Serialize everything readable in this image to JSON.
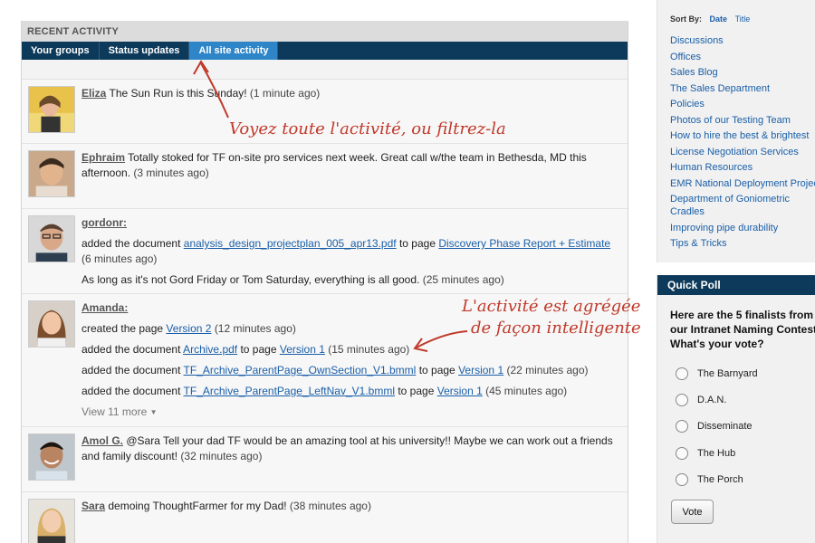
{
  "activity": {
    "header": "RECENT ACTIVITY",
    "tabs": [
      "Your groups",
      "Status updates",
      "All site activity"
    ],
    "items": [
      {
        "user": "Eliza",
        "lines": [
          {
            "text": "The Sun Run is this Sunday!",
            "time": "(1 minute ago)"
          }
        ]
      },
      {
        "user": "Ephraim",
        "lines": [
          {
            "text": "Totally stoked for TF on-site pro services next week. Great call w/the team in Bethesda, MD this afternoon.",
            "time": "(3 minutes ago)"
          }
        ]
      },
      {
        "user": "gordonr:",
        "lines": [
          {
            "pre": "added the document",
            "doc": "analysis_design_projectplan_005_apr13.pdf",
            "mid": "to page",
            "page": "Discovery Phase Report + Estimate",
            "time": "(6 minutes ago)"
          },
          {
            "text": "As long as it's not Gord Friday or Tom Saturday, everything is all good.",
            "time": "(25 minutes ago)"
          }
        ]
      },
      {
        "user": "Amanda:",
        "lines": [
          {
            "pre": "created the page",
            "page": "Version 2",
            "time": "(12 minutes ago)"
          },
          {
            "pre": "added the document",
            "doc": "Archive.pdf",
            "mid": "to page",
            "page": "Version 1",
            "time": "(15 minutes ago)"
          },
          {
            "pre": "added the document",
            "doc": "TF_Archive_ParentPage_OwnSection_V1.bmml",
            "mid": "to page",
            "page": "Version 1",
            "time": "(22 minutes ago)"
          },
          {
            "pre": "added the document",
            "doc": "TF_Archive_ParentPage_LeftNav_V1.bmml",
            "mid": "to page",
            "page": "Version 1",
            "time": "(45 minutes ago)"
          }
        ],
        "view_more": "View 11 more"
      },
      {
        "user": "Amol G.",
        "lines": [
          {
            "text": "@Sara Tell your dad TF would be an amazing tool at his university!! Maybe we can work out a friends and family discount!",
            "time": "(32 minutes ago)"
          }
        ]
      },
      {
        "user": "Sara",
        "lines": [
          {
            "text": "demoing ThoughtFarmer for my Dad!",
            "time": "(38 minutes ago)"
          }
        ]
      }
    ]
  },
  "annotations": {
    "tabs_note": "Voyez toute l'activité, ou filtrez-la",
    "agg_note_1": "L'activité est agrégée",
    "agg_note_2": "de façon intelligente"
  },
  "sidebar": {
    "sort_by": "Sort By:",
    "sort_options": [
      "Date",
      "Title"
    ],
    "items": [
      "Discussions",
      "Offices",
      "Sales Blog",
      "The Sales Department",
      "Policies",
      "Photos of our Testing Team",
      "How to hire the best & brightest",
      "License Negotiation Services",
      "Human Resources",
      "EMR National Deployment Projec",
      "Department of Goniometric Cradles",
      "Improving pipe durability",
      "Tips & Tricks"
    ]
  },
  "poll": {
    "title": "Quick Poll",
    "question_lines": [
      "Here are the 5 finalists from",
      "our Intranet Naming Contest",
      "What's your vote?"
    ],
    "options": [
      "The Barnyard",
      "D.A.N.",
      "Disseminate",
      "The Hub",
      "The Porch"
    ],
    "vote_label": "Vote"
  },
  "colors": {
    "nav_dark": "#0d3a5a",
    "tab_active": "#2e86c8",
    "link": "#1a5fa8",
    "annotation": "#c0392b"
  }
}
